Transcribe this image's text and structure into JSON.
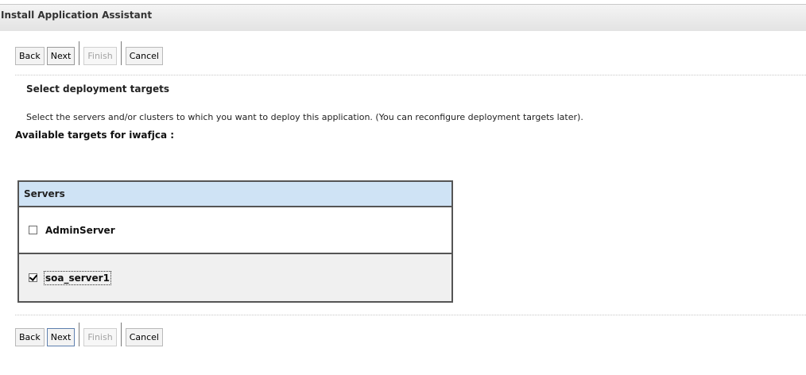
{
  "window": {
    "title": "Install Application Assistant"
  },
  "toolbar": {
    "back_label": "Back",
    "next_label": "Next",
    "finish_label": "Finish",
    "cancel_label": "Cancel"
  },
  "main": {
    "section_title": "Select deployment targets",
    "description": "Select the servers and/or clusters to which you want to deploy this application. (You can reconfigure deployment targets later).",
    "targets_heading": "Available targets for iwafjca :"
  },
  "servers_table": {
    "header": "Servers",
    "rows": [
      {
        "label": "AdminServer",
        "checked": false
      },
      {
        "label": "soa_server1",
        "checked": true
      }
    ]
  },
  "colors": {
    "header_bg": "#cfe3f5",
    "title_bar_bg": "#e8e8e8",
    "disabled_text": "#a3a3a3"
  }
}
